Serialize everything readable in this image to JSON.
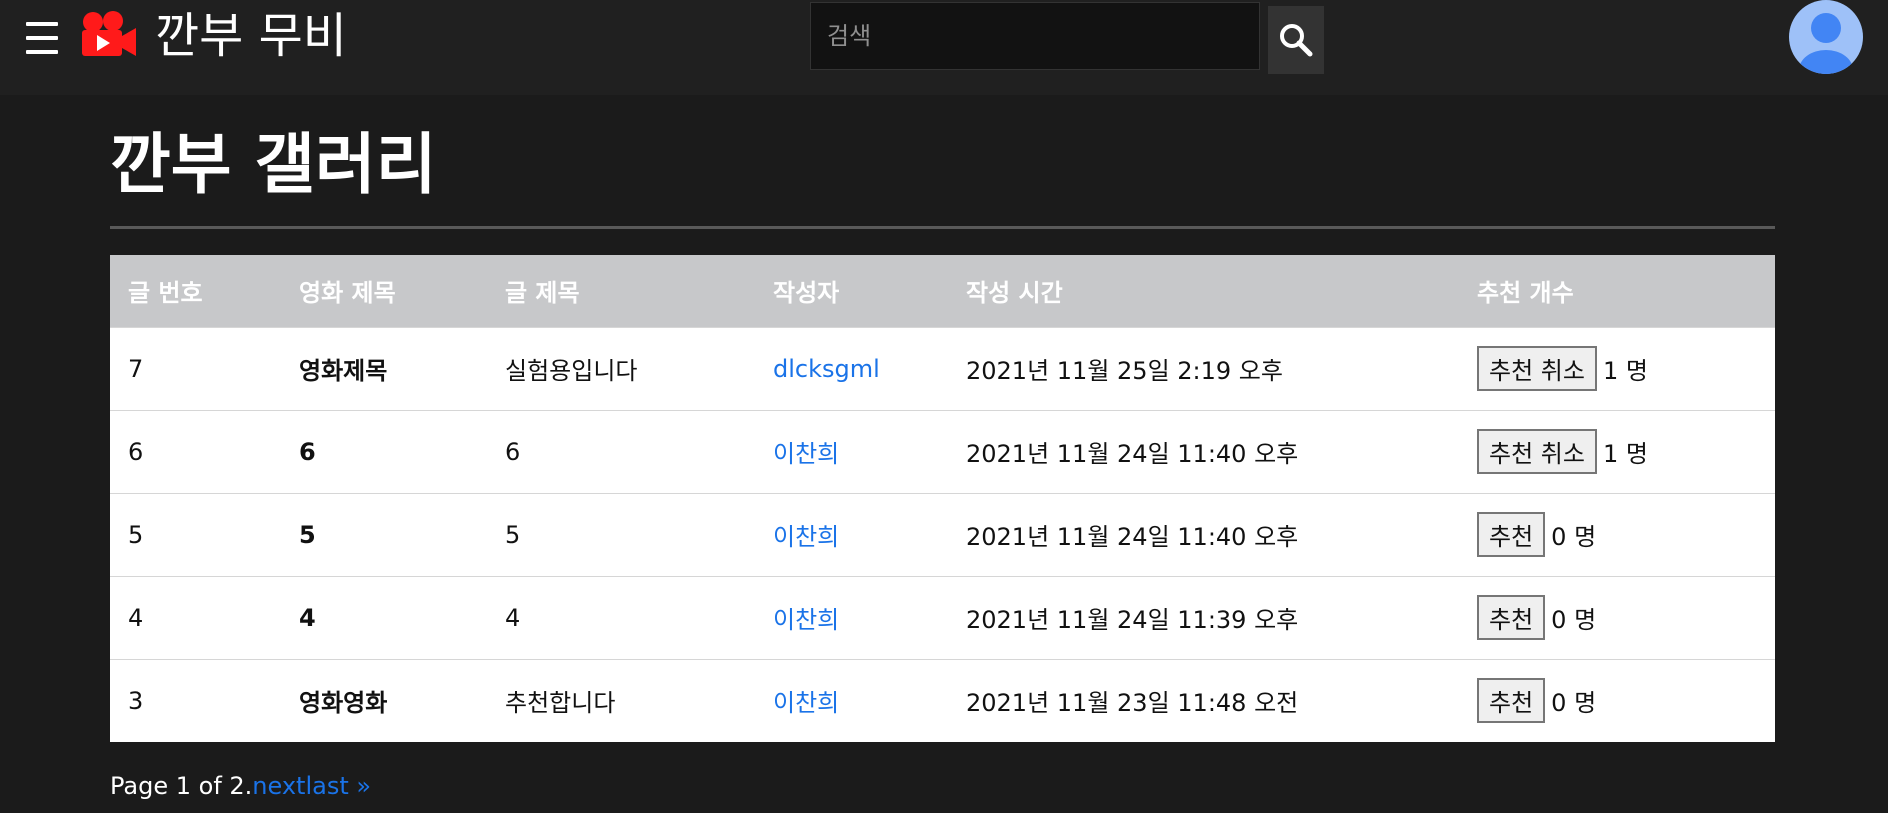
{
  "header": {
    "brand": "깐부 무비",
    "search": {
      "placeholder": "검색",
      "value": ""
    },
    "colors": {
      "background": "#202020",
      "logo": "#ff1a1a",
      "avatar": "#9ec1f8",
      "avatar_figure": "#4285f4"
    },
    "icons": [
      "menu-icon",
      "movie-camera-icon",
      "search-icon",
      "user-avatar-icon"
    ]
  },
  "main": {
    "title": "깐부 갤러리",
    "table": {
      "headers": [
        "글 번호",
        "영화 제목",
        "글 제목",
        "작성자",
        "작성 시간",
        "추천 개수"
      ],
      "rows": [
        {
          "id": "7",
          "movie": "영화제목",
          "title": "실험용입니다",
          "author": "dlcksgml",
          "time": "2021년 11월 25일 2:19 오후",
          "button": "추천 취소",
          "count": "1 명"
        },
        {
          "id": "6",
          "movie": "6",
          "title": "6",
          "author": "이찬희",
          "time": "2021년 11월 24일 11:40 오후",
          "button": "추천 취소",
          "count": "1 명"
        },
        {
          "id": "5",
          "movie": "5",
          "title": "5",
          "author": "이찬희",
          "time": "2021년 11월 24일 11:40 오후",
          "button": "추천",
          "count": "0 명"
        },
        {
          "id": "4",
          "movie": "4",
          "title": "4",
          "author": "이찬희",
          "time": "2021년 11월 24일 11:39 오후",
          "button": "추천",
          "count": "0 명"
        },
        {
          "id": "3",
          "movie": "영화영화",
          "title": "추천합니다",
          "author": "이찬희",
          "time": "2021년 11월 23일 11:48 오전",
          "button": "추천",
          "count": "0 명"
        }
      ]
    },
    "pagination": {
      "info": "Page 1 of 2.",
      "next": "next",
      "last": "last »"
    },
    "colors": {
      "background": "#1b1b1b",
      "table_header": "#c7c8ca",
      "link": "#1a73e8"
    }
  }
}
